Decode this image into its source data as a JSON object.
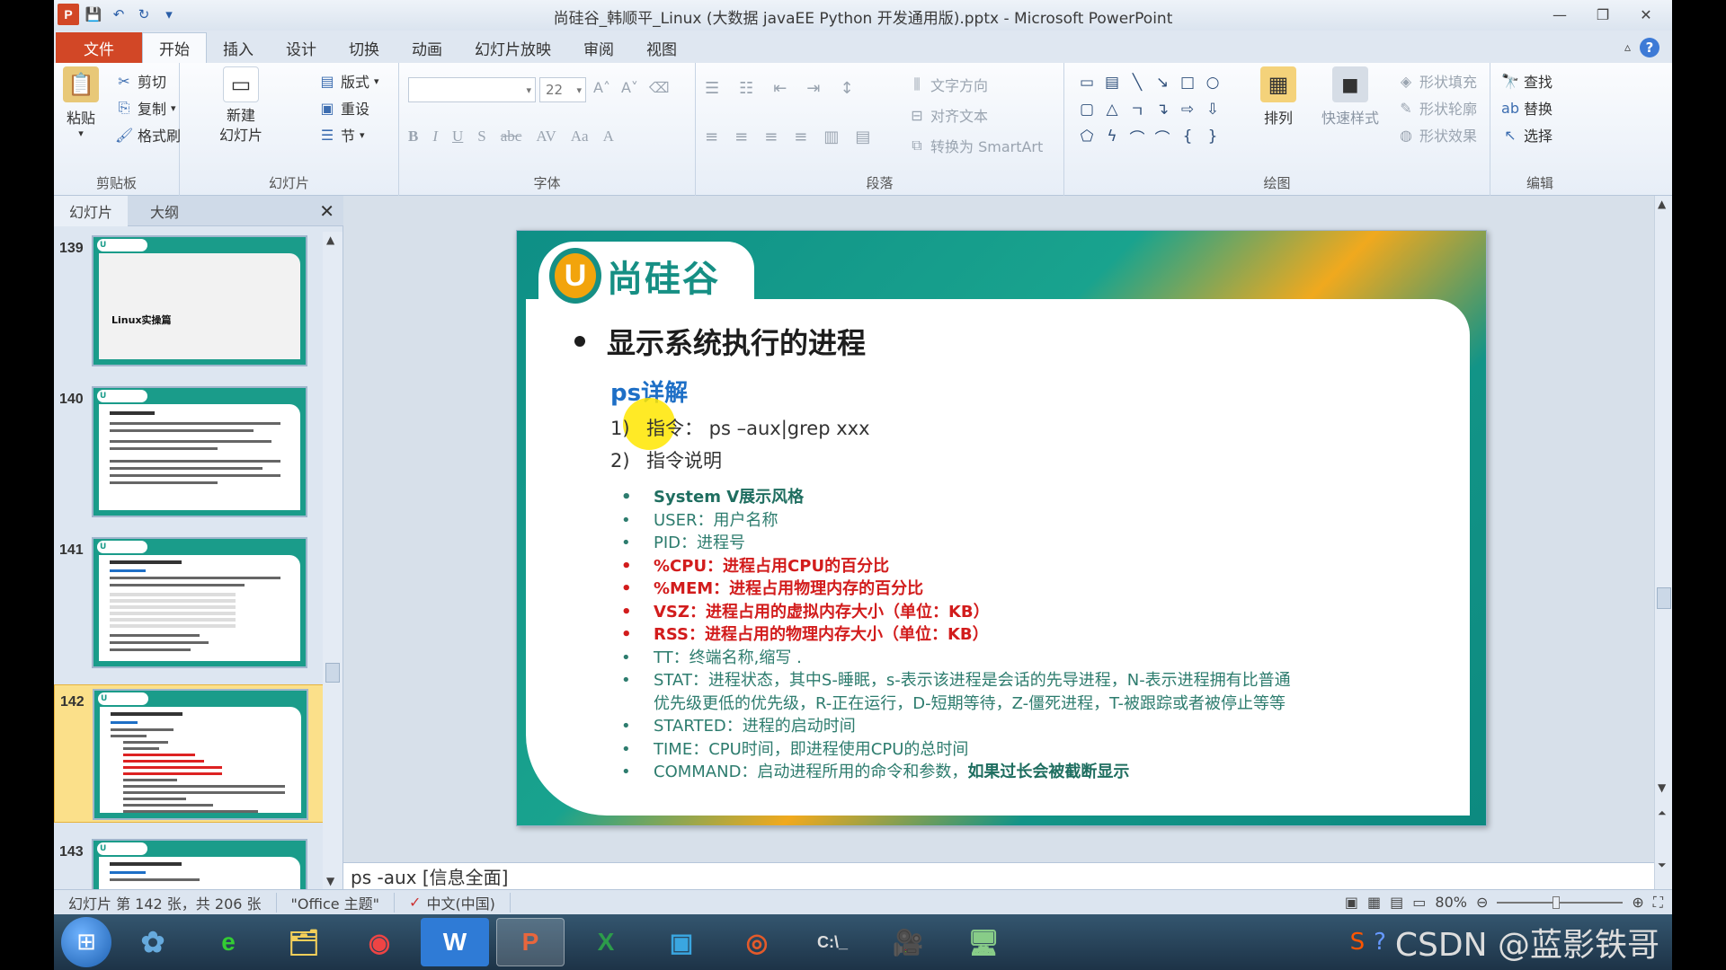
{
  "window": {
    "title": "尚硅谷_韩顺平_Linux (大数据 javaEE Python 开发通用版).pptx - Microsoft PowerPoint",
    "controls": [
      "—",
      "❐",
      "✕"
    ]
  },
  "tabs": [
    "文件",
    "开始",
    "插入",
    "设计",
    "切换",
    "动画",
    "幻灯片放映",
    "审阅",
    "视图"
  ],
  "ribbon": {
    "clipboard": {
      "label": "剪贴板",
      "paste": "粘贴",
      "cut": "剪切",
      "copy": "复制",
      "format_painter": "格式刷"
    },
    "slides": {
      "label": "幻灯片",
      "new_slide": "新建\n幻灯片",
      "layout": "版式",
      "reset": "重设",
      "section": "节"
    },
    "font": {
      "label": "字体",
      "font_name": "",
      "font_size": "22"
    },
    "paragraph": {
      "label": "段落",
      "text_direction": "文字方向",
      "align_text": "对齐文本",
      "convert_smartart": "转换为 SmartArt"
    },
    "drawing": {
      "label": "绘图",
      "arrange": "排列",
      "quick_styles": "快速样式",
      "shape_fill": "形状填充",
      "shape_outline": "形状轮廓",
      "shape_effects": "形状效果"
    },
    "editing": {
      "label": "编辑",
      "find": "查找",
      "replace": "替换",
      "select": "选择"
    }
  },
  "pane": {
    "tab_slides": "幻灯片",
    "tab_outline": "大纲"
  },
  "thumbnails": [
    {
      "num": "139",
      "text": "Linux实操篇"
    },
    {
      "num": "140",
      "text": ""
    },
    {
      "num": "141",
      "text": ""
    },
    {
      "num": "142",
      "text": ""
    },
    {
      "num": "143",
      "text": ""
    }
  ],
  "slide": {
    "logo_letter": "U",
    "logo_text": "尚硅谷",
    "title": "显示系统执行的进程",
    "subtitle": "ps详解",
    "line1_num": "1)",
    "line1": "指令： ps –aux|grep xxx",
    "line2_num": "2)",
    "line2": "指令说明",
    "bullets": {
      "b1": "System V展示风格",
      "b2": "USER：用户名称",
      "b3": "PID：进程号",
      "b4": "%CPU：进程占用CPU的百分比",
      "b5": "%MEM：进程占用物理内存的百分比",
      "b6": "VSZ：进程占用的虚拟内存大小（单位：KB）",
      "b7": "RSS：进程占用的物理内存大小（单位：KB）",
      "b8": "TT：终端名称,缩写 .",
      "b9a": "STAT：进程状态，其中S-睡眠，s-表示该进程是会话的先导进程，N-表示进程拥有比普通",
      "b9b": "优先级更低的优先级，R-正在运行，D-短期等待，Z-僵死进程，T-被跟踪或者被停止等等",
      "b10": "STARTED：进程的启动时间",
      "b11": "TIME：CPU时间，即进程使用CPU的总时间",
      "b12a": "COMMAND：启动进程所用的命令和参数，",
      "b12b": "如果过长会被截断显示"
    }
  },
  "notes": "ps -aux [信息全面]",
  "status": {
    "slide_of": "幻灯片 第 142 张，共 206 张",
    "theme": "\"Office 主题\"",
    "lang": "中文(中国)",
    "zoom": "80%"
  },
  "watermark": "CSDN @蓝影铁哥"
}
